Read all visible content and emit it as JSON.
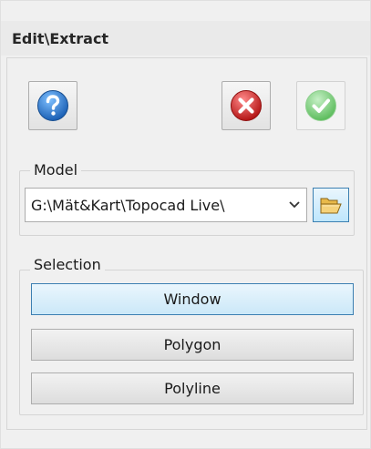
{
  "panel": {
    "title": "Edit\\Extract"
  },
  "toolbar": {
    "help_icon": "question-mark-icon",
    "cancel_icon": "red-x-icon",
    "ok_icon": "green-check-icon",
    "ok_enabled": false
  },
  "model": {
    "legend": "Model",
    "path_value": "G:\\Mät&Kart\\Topocad Live\\",
    "browse_icon": "folder-open-icon"
  },
  "selection": {
    "legend": "Selection",
    "buttons": [
      {
        "label": "Window",
        "active": true
      },
      {
        "label": "Polygon",
        "active": false
      },
      {
        "label": "Polyline",
        "active": false
      }
    ]
  },
  "colors": {
    "help_blue": "#2f7fd0",
    "cancel_red": "#d12b2b",
    "ok_green": "#7ccc7c",
    "active_border": "#3c7fb1"
  }
}
